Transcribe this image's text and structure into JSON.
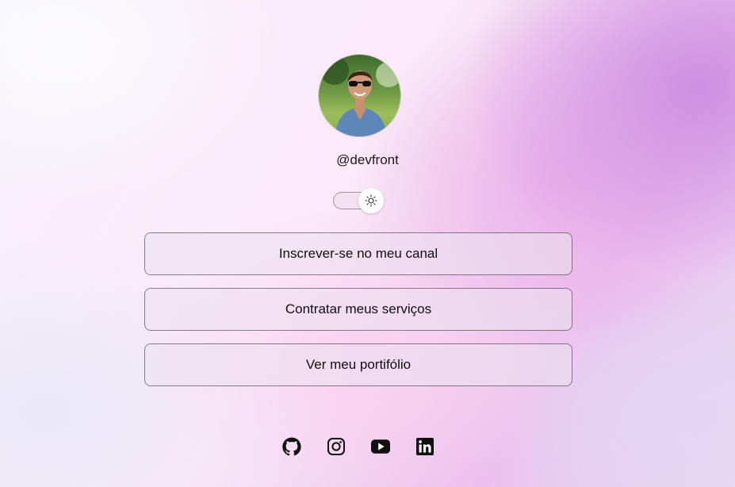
{
  "profile": {
    "username": "@devfront",
    "avatar_icon": "profile-photo"
  },
  "theme_toggle": {
    "icon": "sun-icon"
  },
  "links": [
    {
      "label": "Inscrever-se no meu canal"
    },
    {
      "label": "Contratar meus serviços"
    },
    {
      "label": "Ver meu portifólio"
    }
  ],
  "social": [
    {
      "icon": "github-icon"
    },
    {
      "icon": "instagram-icon"
    },
    {
      "icon": "youtube-icon"
    },
    {
      "icon": "linkedin-icon"
    }
  ],
  "colors": {
    "accent_purple": "#cc8ce2",
    "accent_pink": "#f6c6ee",
    "text": "#111111"
  }
}
